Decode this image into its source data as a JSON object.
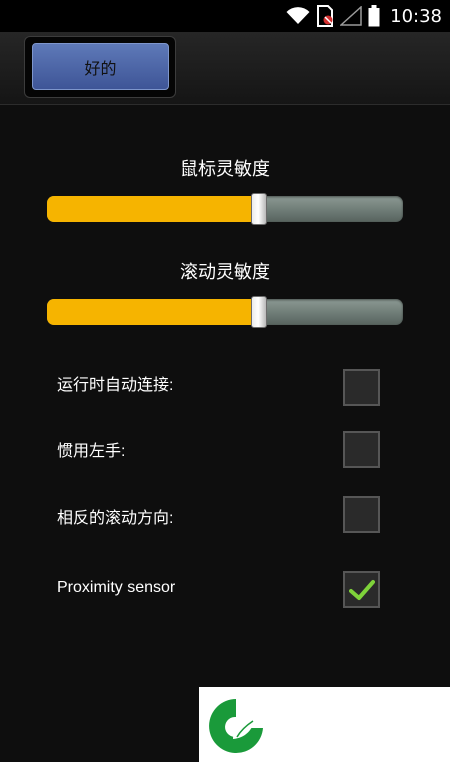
{
  "status_bar": {
    "time": "10:38",
    "icons": [
      "wifi-icon",
      "sim-card-icon",
      "signal-icon",
      "battery-icon"
    ]
  },
  "action_bar": {
    "ok_label": "好的"
  },
  "sliders": [
    {
      "title": "鼠标灵敏度",
      "value_fraction": 0.595,
      "fill_color": "#f6b400"
    },
    {
      "title": "滚动灵敏度",
      "value_fraction": 0.595,
      "fill_color": "#f6b400"
    }
  ],
  "options": [
    {
      "label": "运行时自动连接:",
      "checked": false
    },
    {
      "label": "惯用左手:",
      "checked": false
    },
    {
      "label": "相反的滚动方向:",
      "checked": false
    },
    {
      "label": "Proximity sensor",
      "checked": true
    }
  ],
  "colors": {
    "accent": "#f6b400",
    "button": "#4a62a5",
    "check": "#7ed23a",
    "logo": "#1a9a3a"
  },
  "watermark": {
    "icon": "leaf-logo-icon"
  }
}
